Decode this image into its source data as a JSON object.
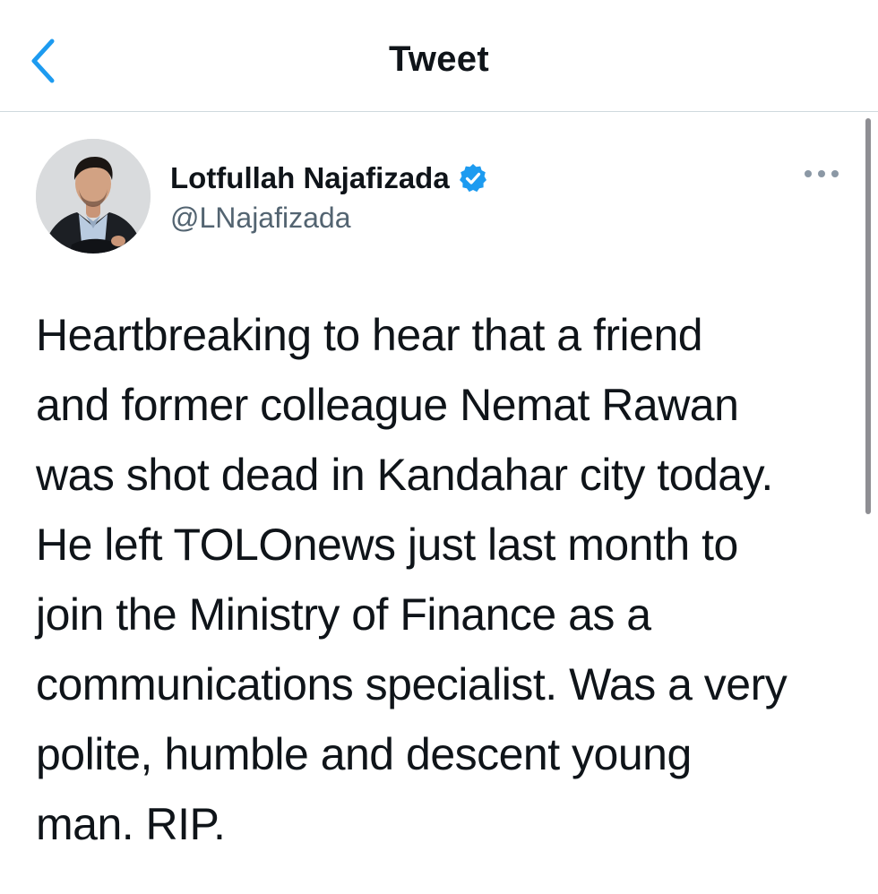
{
  "header": {
    "title": "Tweet",
    "back_icon": "chevron-left-icon"
  },
  "tweet": {
    "author": {
      "name": "Lotfullah Najafizada",
      "handle": "@LNajafizada",
      "verified": true,
      "verified_icon": "verified-badge-icon"
    },
    "more_icon": "more-horizontal-icon",
    "text": "Heartbreaking to hear that a friend\nand former colleague Nemat Rawan\nwas shot dead in Kandahar city today.\nHe left TOLOnews just last month to\njoin the Ministry of Finance as a\ncommunications specialist. Was a very\npolite, humble and descent young\nman. RIP."
  },
  "colors": {
    "accent": "#1d9bf0",
    "text_primary": "#0f1419",
    "text_secondary": "#536471",
    "divider": "#cfd9de"
  }
}
